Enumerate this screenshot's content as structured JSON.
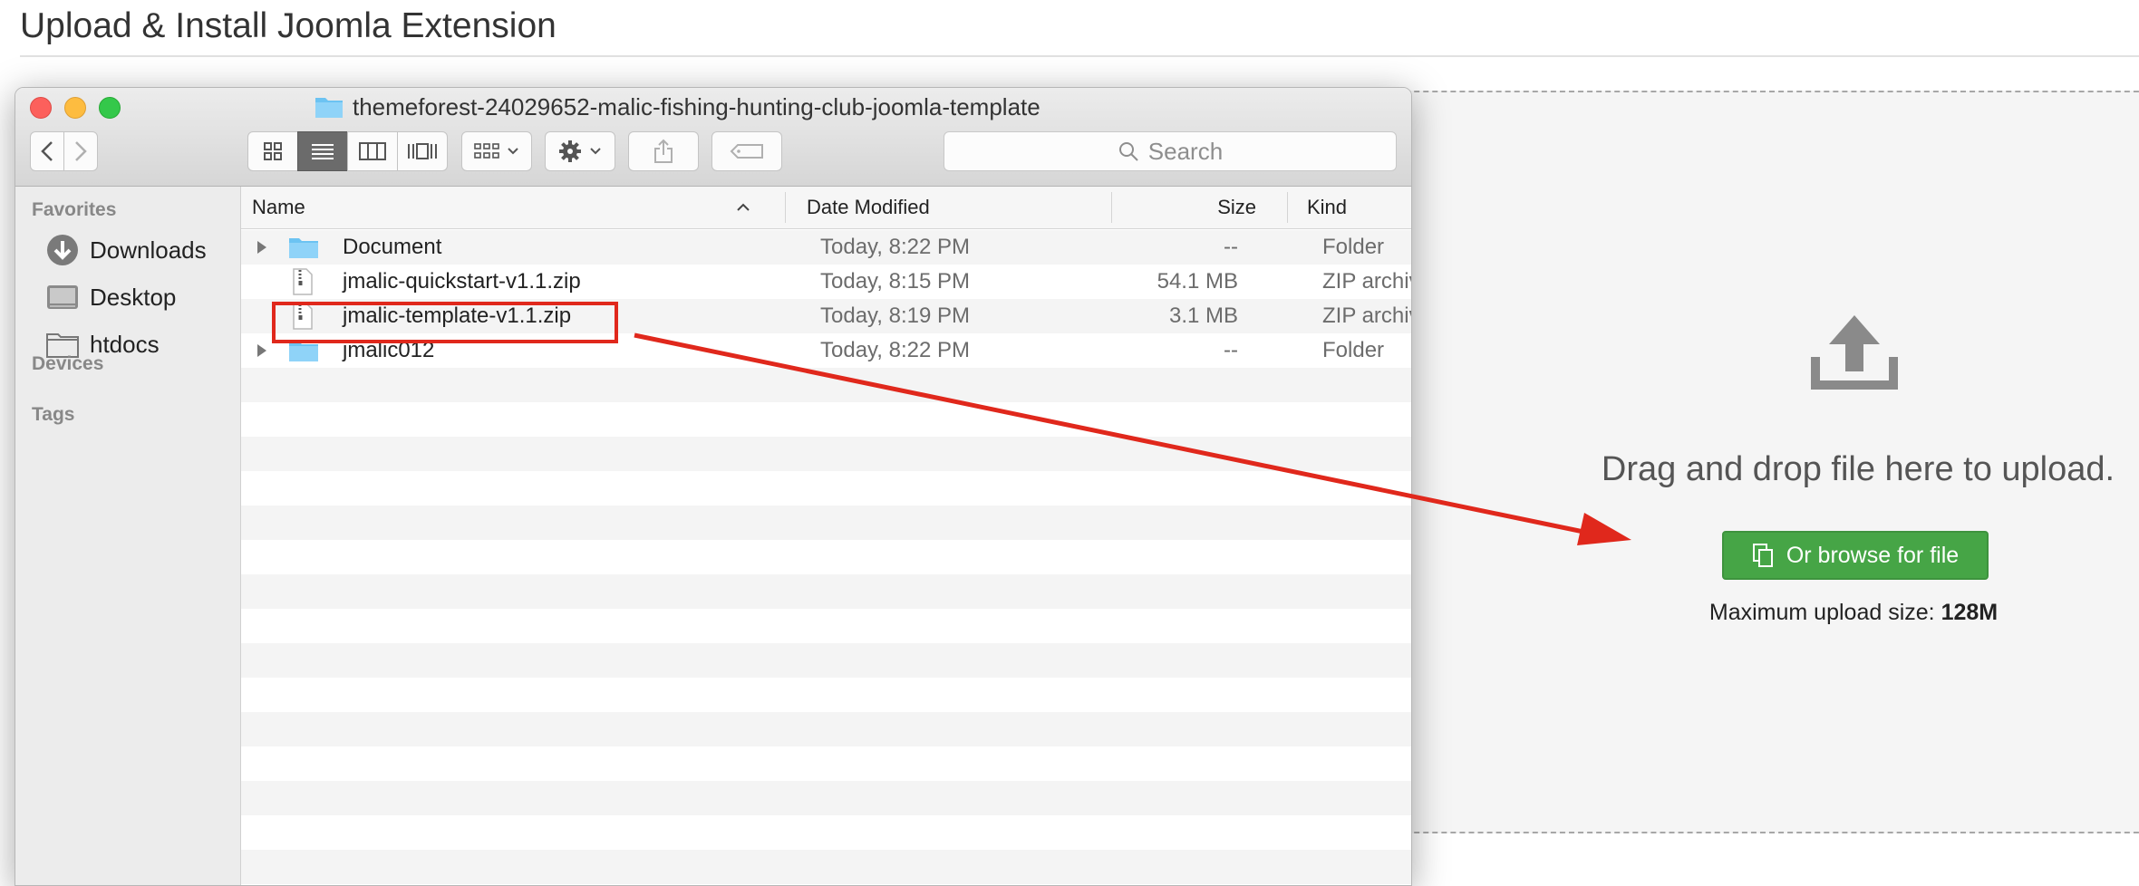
{
  "page": {
    "title": "Upload & Install Joomla Extension"
  },
  "dropzone": {
    "instruction": "Drag and drop file here to upload.",
    "browse_label": "Or browse for file",
    "max_label": "Maximum upload size:",
    "max_value": "128M",
    "button_color": "#46a546"
  },
  "finder": {
    "window_title": "themeforest-24029652-malic-fishing-hunting-club-joomla-template",
    "search_placeholder": "Search",
    "sidebar": {
      "favorites_label": "Favorites",
      "items": [
        {
          "label": "Downloads",
          "icon": "downloads-icon"
        },
        {
          "label": "Desktop",
          "icon": "desktop-icon"
        },
        {
          "label": "htdocs",
          "icon": "folder-icon"
        }
      ],
      "devices_label": "Devices",
      "tags_label": "Tags"
    },
    "columns": {
      "name": "Name",
      "date": "Date Modified",
      "size": "Size",
      "kind": "Kind"
    },
    "files": [
      {
        "name": "Document",
        "date": "Today, 8:22 PM",
        "size": "--",
        "kind": "Folder",
        "type": "folder"
      },
      {
        "name": "jmalic-quickstart-v1.1.zip",
        "date": "Today, 8:15 PM",
        "size": "54.1 MB",
        "kind": "ZIP archiv",
        "type": "zip"
      },
      {
        "name": "jmalic-template-v1.1.zip",
        "date": "Today, 8:19 PM",
        "size": "3.1 MB",
        "kind": "ZIP archiv",
        "type": "zip"
      },
      {
        "name": "jmalic012",
        "date": "Today, 8:22 PM",
        "size": "--",
        "kind": "Folder",
        "type": "folder"
      }
    ]
  },
  "annotation": {
    "color": "#e0281c"
  }
}
